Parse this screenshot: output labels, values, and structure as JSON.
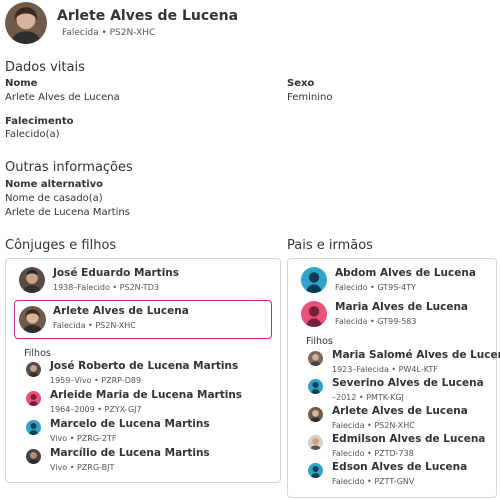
{
  "header": {
    "name": "Arlete Alves de Lucena",
    "status": "Falecida",
    "id": "PS2N-XHC",
    "avatar": "woman-photo-avatar"
  },
  "vital": {
    "title": "Dados vitais",
    "name_label": "Nome",
    "name_value": "Arlete Alves de Lucena",
    "sex_label": "Sexo",
    "sex_value": "Feminino",
    "death_label": "Falecimento",
    "death_value": "Falecido(a)"
  },
  "other": {
    "title": "Outras informações",
    "alt_label": "Nome alternativo",
    "alt_type": "Nome de casado(a)",
    "alt_value": "Arlete de Lucena Martins"
  },
  "spouses": {
    "title": "Cônjuges e filhos",
    "spouse": {
      "name": "José Eduardo Martins",
      "meta": "1938–Falecido • PS2N-TD3",
      "avatar": "man-photo-avatar"
    },
    "self": {
      "name": "Arlete Alves de Lucena",
      "meta": "Falecida • PS2N-XHC",
      "avatar": "woman-photo-avatar"
    },
    "children_label": "Filhos",
    "children": [
      {
        "name": "José Roberto de Lucena Martins",
        "meta": "1959–Vivo • PZRP-D89",
        "avatar": "man-photo-avatar"
      },
      {
        "name": "Arleide Maria de Lucena Martins",
        "meta": "1964–2009 • PZYX-GJ7",
        "avatar": "female-silhouette-avatar"
      },
      {
        "name": "Marcelo de Lucena Martins",
        "meta": "Vivo • PZRG-2TF",
        "avatar": "male-silhouette-avatar"
      },
      {
        "name": "Marcílio de Lucena Martins",
        "meta": "Vivo • PZRG-BJT",
        "avatar": "man-photo-avatar"
      }
    ]
  },
  "parents": {
    "title": "Pais e irmãos",
    "father": {
      "name": "Abdom Alves de Lucena",
      "meta": "Falecido • GT9S-4TY",
      "avatar": "male-silhouette-avatar"
    },
    "mother": {
      "name": "Maria Alves de Lucena",
      "meta": "Falecida • GT99-583",
      "avatar": "female-silhouette-avatar"
    },
    "children_label": "Filhos",
    "siblings": [
      {
        "name": "Maria Salomé Alves de Lucena",
        "meta": "1923–Falecida • PW4L-KTF",
        "avatar": "woman-photo-avatar"
      },
      {
        "name": "Severino Alves de Lucena",
        "meta": "–2012 • PMTK-KGJ",
        "avatar": "male-silhouette-avatar"
      },
      {
        "name": "Arlete Alves de Lucena",
        "meta": "Falecida • PS2N-XHC",
        "avatar": "woman-photo-avatar"
      },
      {
        "name": "Edmilson Alves de Lucena",
        "meta": "Falecido • PZTD-738",
        "avatar": "man-photo-avatar"
      },
      {
        "name": "Edson Alves de Lucena",
        "meta": "Falecido • PZTT-GNV",
        "avatar": "male-silhouette-avatar"
      }
    ]
  },
  "colors": {
    "selected_border": "#c0307a",
    "male_silhouette_bg": "#2fa3c9",
    "female_silhouette_bg": "#e9517a"
  }
}
